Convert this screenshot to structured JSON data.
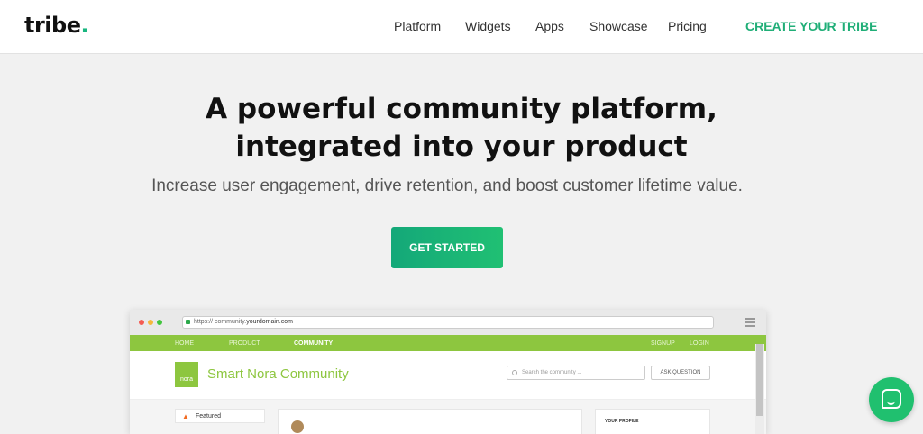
{
  "brand": {
    "name": "tribe",
    "dot": ".",
    "accent": "#18b67f"
  },
  "nav": {
    "items": [
      "Platform",
      "Widgets",
      "Apps",
      "Showcase",
      "Pricing"
    ],
    "cta": "CREATE YOUR TRIBE"
  },
  "hero": {
    "title_line1": "A powerful community platform,",
    "title_line2": "integrated into your product",
    "subtitle": "Increase user engagement, drive retention, and boost customer lifetime value.",
    "button": "GET STARTED"
  },
  "mockup": {
    "address_prefix": "https:// community.",
    "address_host": "yourdomain.com",
    "nav_left": [
      "HOME",
      "PRODUCT",
      "COMMUNITY"
    ],
    "nav_right": [
      "SIGNUP",
      "LOGIN"
    ],
    "logo_text": "nora",
    "brand_name": "Smart Nora",
    "brand_suffix": "Community",
    "search_placeholder": "Search the community ...",
    "ask_button": "ASK QUESTION",
    "featured_label": "Featured",
    "profile_label": "YOUR PROFILE",
    "brand_color": "#8dc63f"
  },
  "chat": {
    "icon": "chat-icon"
  }
}
